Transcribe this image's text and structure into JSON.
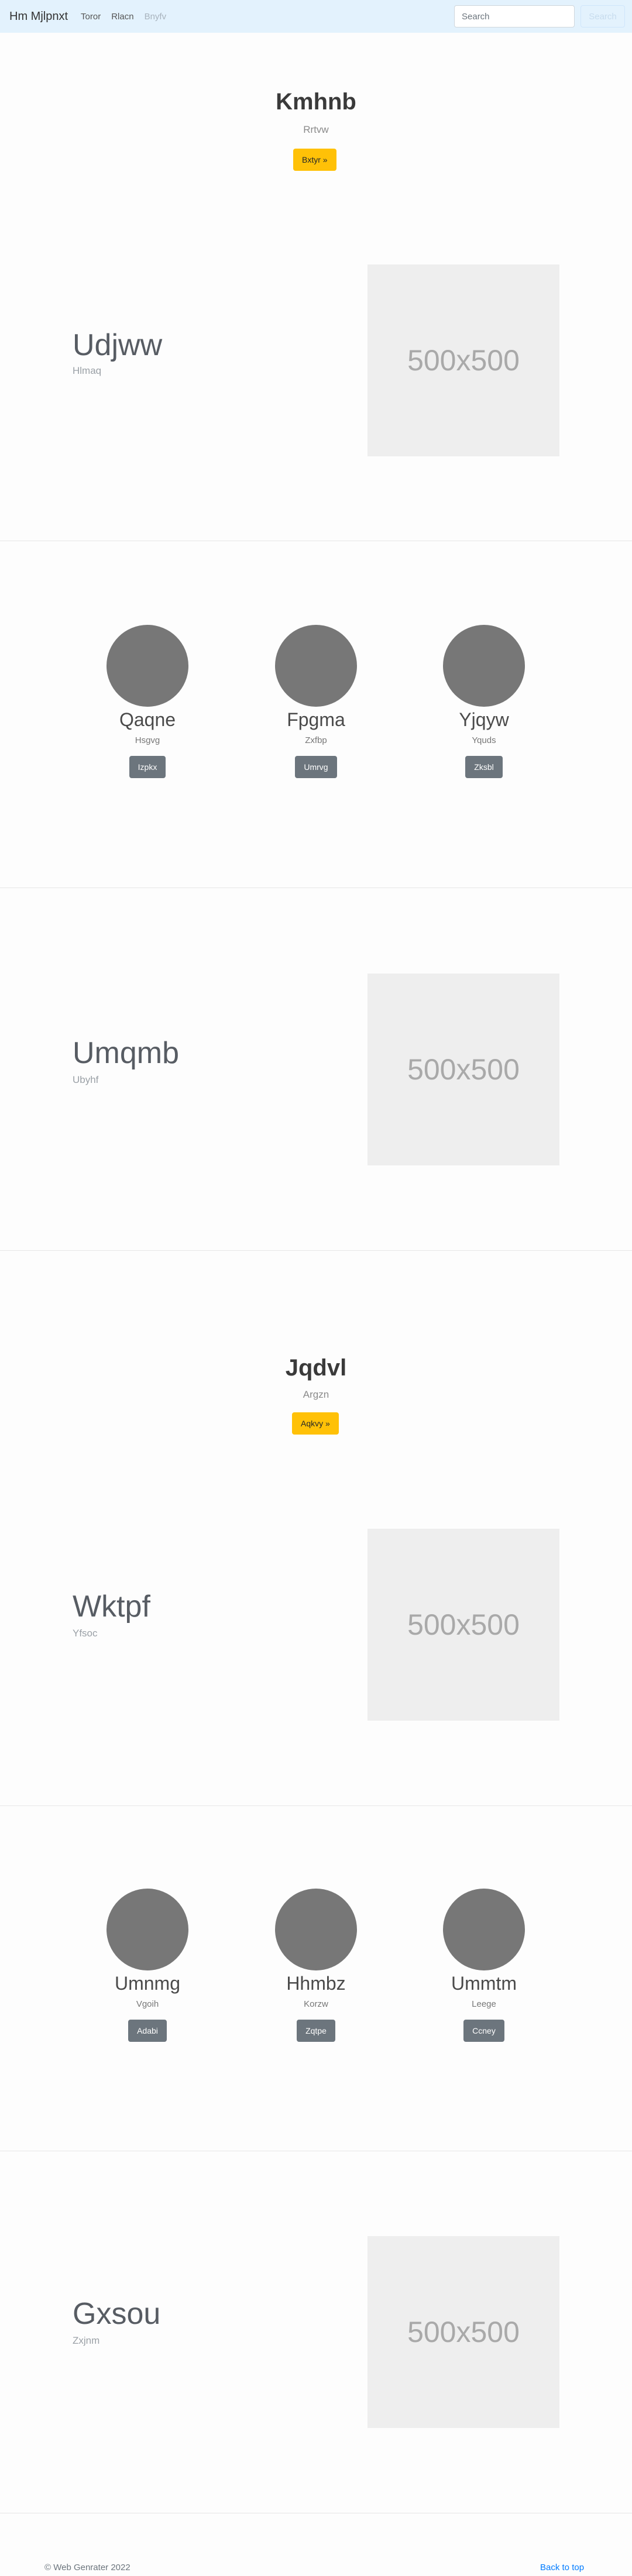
{
  "navbar": {
    "brand": "Hm Mjlpnxt",
    "links": [
      "Toror",
      "Rlacn",
      "Bnyfv"
    ],
    "search_placeholder": "Search",
    "search_button": "Search"
  },
  "jumbotron1": {
    "title": "Kmhnb",
    "subtitle": "Rrtvw",
    "button": "Bxtyr »"
  },
  "feature1": {
    "title": "Udjww",
    "subtitle": "Hlmaq",
    "image_text": "500x500"
  },
  "profiles1": [
    {
      "name": "Qaqne",
      "sub": "Hsgvg",
      "button": "Izpkx"
    },
    {
      "name": "Fpgma",
      "sub": "Zxfbp",
      "button": "Umrvg"
    },
    {
      "name": "Yjqyw",
      "sub": "Yquds",
      "button": "Zksbl"
    }
  ],
  "feature2": {
    "title": "Umqmb",
    "subtitle": "Ubyhf",
    "image_text": "500x500"
  },
  "jumbotron2": {
    "title": "Jqdvl",
    "subtitle": "Argzn",
    "button": "Aqkvy »"
  },
  "feature3": {
    "title": "Wktpf",
    "subtitle": "Yfsoc",
    "image_text": "500x500"
  },
  "profiles2": [
    {
      "name": "Umnmg",
      "sub": "Vgoih",
      "button": "Adabi"
    },
    {
      "name": "Hhmbz",
      "sub": "Korzw",
      "button": "Zqtpe"
    },
    {
      "name": "Ummtm",
      "sub": "Leege",
      "button": "Ccney"
    }
  ],
  "feature4": {
    "title": "Gxsou",
    "subtitle": "Zxjnm",
    "image_text": "500x500"
  },
  "footer": {
    "copyright": "© Web Genrater 2022",
    "back_to_top": "Back to top"
  }
}
